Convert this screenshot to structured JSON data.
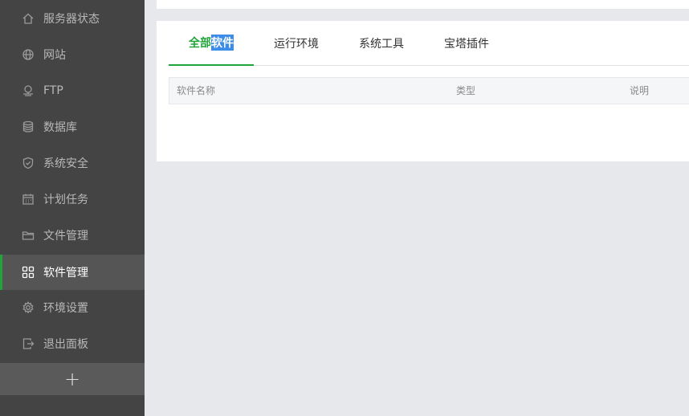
{
  "sidebar": {
    "items": [
      {
        "label": "服务器状态",
        "icon": "home-icon"
      },
      {
        "label": "网站",
        "icon": "globe-icon"
      },
      {
        "label": "FTP",
        "icon": "ftp-icon"
      },
      {
        "label": "数据库",
        "icon": "database-icon"
      },
      {
        "label": "系统安全",
        "icon": "shield-icon"
      },
      {
        "label": "计划任务",
        "icon": "calendar-icon"
      },
      {
        "label": "文件管理",
        "icon": "folder-icon"
      },
      {
        "label": "软件管理",
        "icon": "apps-grid-icon",
        "active": true
      },
      {
        "label": "环境设置",
        "icon": "gear-icon"
      },
      {
        "label": "退出面板",
        "icon": "logout-icon"
      }
    ],
    "add_label": "+"
  },
  "tabs": [
    {
      "label_a": "全部",
      "label_b": "软件",
      "active": true
    },
    {
      "label": "运行环境"
    },
    {
      "label": "系统工具"
    },
    {
      "label": "宝塔插件"
    }
  ],
  "table": {
    "headers": [
      "软件名称",
      "类型",
      "说明"
    ]
  },
  "colors": {
    "accent": "#20a53a",
    "sidebar": "#444444",
    "selection": "#3b8de9"
  }
}
